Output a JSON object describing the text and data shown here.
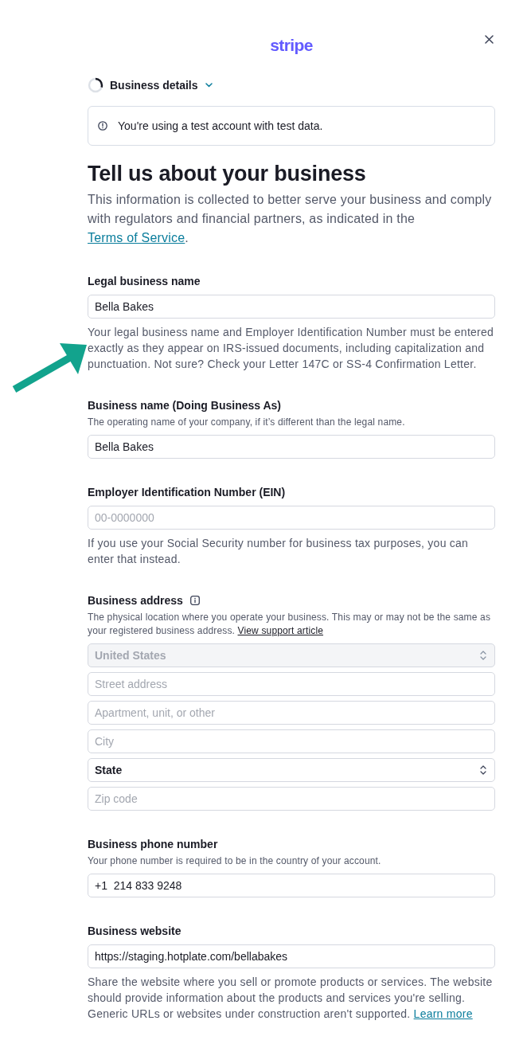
{
  "header": {
    "logo": "stripe"
  },
  "step": {
    "label": "Business details",
    "level": 0.3
  },
  "notice": {
    "text": "You're using a test account with test data."
  },
  "title": "Tell us about your business",
  "intro": {
    "text": "This information is collected to better serve your business and comply with regulators and financial partners, as indicated in the",
    "link": "Terms of Service",
    "after": "."
  },
  "sections": [
    {
      "label": "Legal business name",
      "fields": [
        {
          "kind": "text",
          "value": "Bella Bakes",
          "disabled": false
        }
      ],
      "note": {
        "text": "Your legal business name and Employer Identification Number must be entered exactly as they appear on IRS-issued documents, including capitalization and punctuation. Not sure? Check your Letter 147C or SS-4 Confirmation Letter."
      }
    },
    {
      "label": "Business name (Doing Business As)",
      "hint": {
        "text": "The operating name of your company, if it’s different than the legal name."
      },
      "fields": [
        {
          "kind": "text",
          "value": "Bella Bakes",
          "disabled": false
        }
      ]
    },
    {
      "label": "Employer Identification Number (EIN)",
      "fields": [
        {
          "kind": "text",
          "placeholder": "00-0000000",
          "disabled": false
        }
      ],
      "note": {
        "text": "If you use your Social Security number for business tax purposes, you can enter that instead."
      }
    },
    {
      "label": "Business address",
      "info_tip": true,
      "hint": {
        "text": "The physical location where you operate your business. This may or may not be the same as your registered business address.",
        "link": "View support article"
      },
      "fields": [
        {
          "kind": "select",
          "value": "United States",
          "disabled": true
        },
        {
          "kind": "text",
          "placeholder": "Street address",
          "disabled": false
        },
        {
          "kind": "text",
          "placeholder": "Apartment, unit, or other",
          "disabled": false
        },
        {
          "kind": "text",
          "placeholder": "City",
          "disabled": false
        },
        {
          "kind": "select",
          "value": "State",
          "disabled": false
        },
        {
          "kind": "text",
          "placeholder": "Zip code",
          "disabled": false
        }
      ]
    },
    {
      "label": "Business phone number",
      "hint": {
        "text": "Your phone number is required to be in the country of your account."
      },
      "fields": [
        {
          "kind": "text",
          "value": "+1  214 833 9248",
          "disabled": false
        }
      ]
    },
    {
      "label": "Business website",
      "fields": [
        {
          "kind": "text",
          "value": "https://staging.hotplate.com/bellabakes",
          "disabled": false
        }
      ],
      "note": {
        "text": "Share the website where you sell or promote products or services. The website should provide information about the products and services you're selling. Generic URLs or websites under construction aren't supported.",
        "link": "Learn more"
      }
    }
  ]
}
